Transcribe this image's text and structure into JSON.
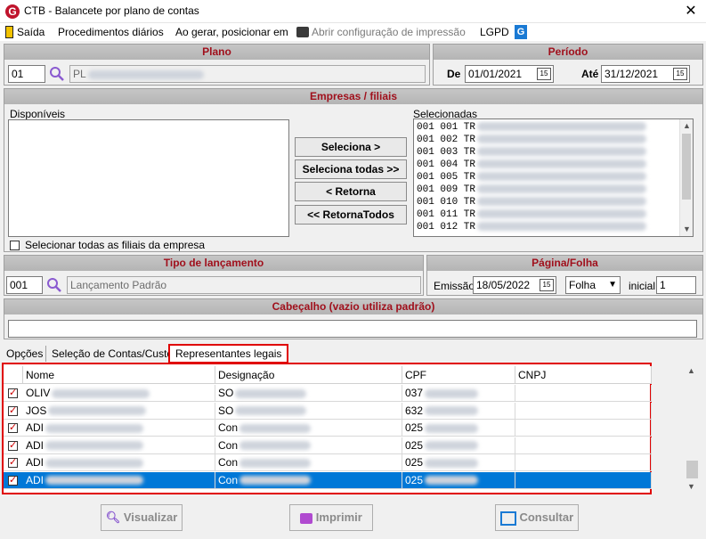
{
  "window": {
    "title": "CTB - Balancete por plano de contas",
    "close": "✕",
    "logo": "G"
  },
  "menu": {
    "saida": "Saída",
    "procedimentos": "Procedimentos diários",
    "ao_gerar": "Ao gerar, posicionar em",
    "abrir_config": "Abrir configuração de impressão",
    "lgpd": "LGPD"
  },
  "plano": {
    "header": "Plano",
    "code": "01",
    "name_prefix": "PL"
  },
  "periodo": {
    "header": "Período",
    "de_label": "De",
    "de_value": "01/01/2021",
    "ate_label": "Até",
    "ate_value": "31/12/2021"
  },
  "empresas": {
    "header": "Empresas / filiais",
    "disponiveis_label": "Disponíveis",
    "selecionadas_label": "Selecionadas",
    "selecionadas": [
      "001 001 TR",
      "001 002 TR",
      "001 003 TR",
      "001 004 TR",
      "001 005 TR",
      "001 009 TR",
      "001 010 TR",
      "001 011 TR",
      "001 012 TR"
    ],
    "btn_seleciona": "Seleciona >",
    "btn_seleciona_todas": "Seleciona todas >>",
    "btn_retorna": "< Retorna",
    "btn_retorna_todos": "<< RetornaTodos",
    "select_all_label": "Selecionar todas as filiais da empresa"
  },
  "tipo": {
    "header": "Tipo de lançamento",
    "code": "001",
    "name": "Lançamento Padrão"
  },
  "pagina": {
    "header": "Página/Folha",
    "emissao_label": "Emissão",
    "emissao_value": "18/05/2022",
    "folha_value": "Folha",
    "inicial_label": "inicial",
    "inicial_value": "1"
  },
  "cabecalho": {
    "header": "Cabeçalho (vazio utiliza padrão)",
    "value": ""
  },
  "tabs": [
    "Opções",
    "Seleção de Contas/Custos",
    "Representantes legais"
  ],
  "grid": {
    "columns": [
      "Nome",
      "Designação",
      "CPF",
      "CNPJ"
    ],
    "rows": [
      {
        "nome": "OLIV",
        "designacao": "SO",
        "cpf": "037",
        "checked": true
      },
      {
        "nome": "JOS",
        "designacao": "SO",
        "cpf": "632",
        "checked": true
      },
      {
        "nome": "ADI",
        "designacao": "Con",
        "cpf": "025",
        "checked": true
      },
      {
        "nome": "ADI",
        "designacao": "Con",
        "cpf": "025",
        "checked": true
      },
      {
        "nome": "ADI",
        "designacao": "Con",
        "cpf": "025",
        "checked": true
      },
      {
        "nome": "ADI",
        "designacao": "Con",
        "cpf": "025",
        "checked": true
      }
    ]
  },
  "buttons": {
    "visualizar": "Visualizar",
    "imprimir": "Imprimir",
    "consultar": "Consultar"
  },
  "colors": {
    "accent_red": "#a0101c",
    "highlight_red": "#e00000",
    "selection_blue": "#0078d7"
  }
}
